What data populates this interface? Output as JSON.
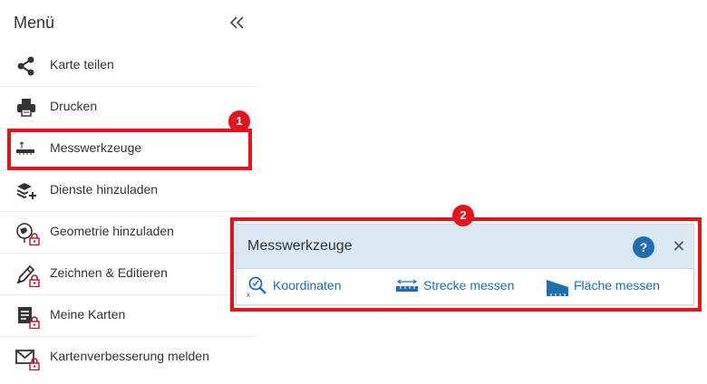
{
  "menu": {
    "title": "Menü",
    "collapse_icon": "double-chevron-left-icon",
    "items": [
      {
        "label": "Karte teilen",
        "icon": "share-icon",
        "locked": false
      },
      {
        "label": "Drucken",
        "icon": "printer-icon",
        "locked": false
      },
      {
        "label": "Messwerkzeuge",
        "icon": "ruler-icon",
        "locked": false
      },
      {
        "label": "Dienste hinzuladen",
        "icon": "layers-add-icon",
        "locked": false
      },
      {
        "label": "Geometrie hinzuladen",
        "icon": "globe-pin-icon",
        "locked": true
      },
      {
        "label": "Zeichnen & Editieren",
        "icon": "pencil-icon",
        "locked": true
      },
      {
        "label": "Meine Karten",
        "icon": "document-icon",
        "locked": true
      },
      {
        "label": "Kartenverbesserung melden",
        "icon": "mail-icon",
        "locked": true
      }
    ]
  },
  "callouts": {
    "first": "1",
    "second": "2"
  },
  "panel": {
    "title": "Messwerkzeuge",
    "help_label": "?",
    "close_label": "✕",
    "tools": [
      {
        "label": "Koordinaten",
        "icon": "coordinate-search-icon"
      },
      {
        "label": "Strecke messen",
        "icon": "distance-ruler-icon"
      },
      {
        "label": "Fläche messen",
        "icon": "area-measure-icon"
      }
    ]
  },
  "colors": {
    "highlight": "#e4141b",
    "link_blue": "#1f6fb0",
    "panel_header": "#dce8f1",
    "lock_red": "#b0182b"
  }
}
